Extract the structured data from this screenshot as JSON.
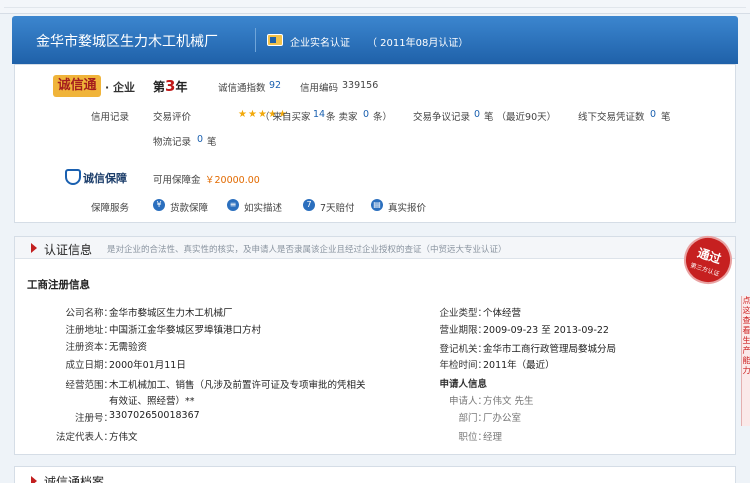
{
  "header": {
    "company_name": "金华市婺城区生力木工机械厂",
    "cert_label": "企业实名认证",
    "cert_date": "（ 2011年08月认证）"
  },
  "credit": {
    "logo_text": "诚信通",
    "logo_sub": "· 企业",
    "year_prefix": "第",
    "year_num": "3",
    "year_suffix": "年",
    "index_label": "诚信通指数",
    "index_value": "92",
    "code_label": "信用编码",
    "code_value": "339156",
    "record_label": "信用记录",
    "trade_eval_label": "交易评价",
    "stars": 5,
    "from_buyer_label": "（ 来自买家",
    "from_buyer_value": "14",
    "from_buyer_unit": "条  卖家",
    "seller_value": "0",
    "seller_unit": "条）",
    "dispute_label": "交易争议记录",
    "dispute_value": "0",
    "dispute_unit": "笔  （最近90天）",
    "offline_label": "线下交易凭证数",
    "offline_value": "0",
    "offline_unit": "笔",
    "logistics_label": "物流记录",
    "logistics_value": "0",
    "logistics_unit": "笔"
  },
  "guarantee": {
    "title": "诚信保障",
    "deposit_label": "可用保障金",
    "deposit_value": "￥20000.00",
    "service_label": "保障服务",
    "services": [
      {
        "label": "货款保障",
        "icon": "yen-icon"
      },
      {
        "label": "如实描述",
        "icon": "doc-icon"
      },
      {
        "label": "7天赔付",
        "icon": "seven-icon"
      },
      {
        "label": "真实报价",
        "icon": "price-icon"
      }
    ]
  },
  "certification": {
    "title": "认证信息",
    "note": "是对企业的合法性、真实性的核实，及申请人是否隶属该企业且经过企业授权的查证（中贸远大专业认证）",
    "section_title": "工商注册信息",
    "left": [
      {
        "label": "公司名称：",
        "value": "金华市婺城区生力木工机械厂"
      },
      {
        "label": "注册地址：",
        "value": "中国浙江金华婺城区罗埠镇港口方村"
      },
      {
        "label": "注册资本：",
        "value": "无需验资"
      },
      {
        "label": "成立日期：",
        "value": "2000年01月11日"
      },
      {
        "label": "经营范围：",
        "value": "木工机械加工、销售（凡涉及前置许可证及专项审批的凭相关"
      },
      {
        "label": "",
        "value": "有效证、照经营）**"
      },
      {
        "label": "注册号：",
        "value": "330702650018367"
      },
      {
        "label": "法定代表人：",
        "value": "方伟文"
      }
    ],
    "right": [
      {
        "label": "企业类型：",
        "value": "个体经营"
      },
      {
        "label": "营业期限：",
        "value": "2009-09-23 至 2013-09-22"
      },
      {
        "label": "登记机关：",
        "value": "金华市工商行政管理局婺城分局"
      },
      {
        "label": "年检时间：",
        "value": "2011年（最近）"
      }
    ],
    "applicant_title": "申请人信息",
    "applicant": [
      {
        "label": "申请人：",
        "value": "方伟文  先生"
      },
      {
        "label": "部门：",
        "value": "厂办公室"
      },
      {
        "label": "职位：",
        "value": "经理"
      }
    ],
    "stamp_main": "通过",
    "stamp_sub": "第三方认证",
    "ribbon_text": "点这查看生产能力"
  },
  "next_section": {
    "title": "诚信通档案"
  },
  "colors": {
    "header_blue": "#1f61a9",
    "link_blue": "#1a60b0",
    "orange": "#e26a00",
    "stamp_red": "#c62020"
  }
}
